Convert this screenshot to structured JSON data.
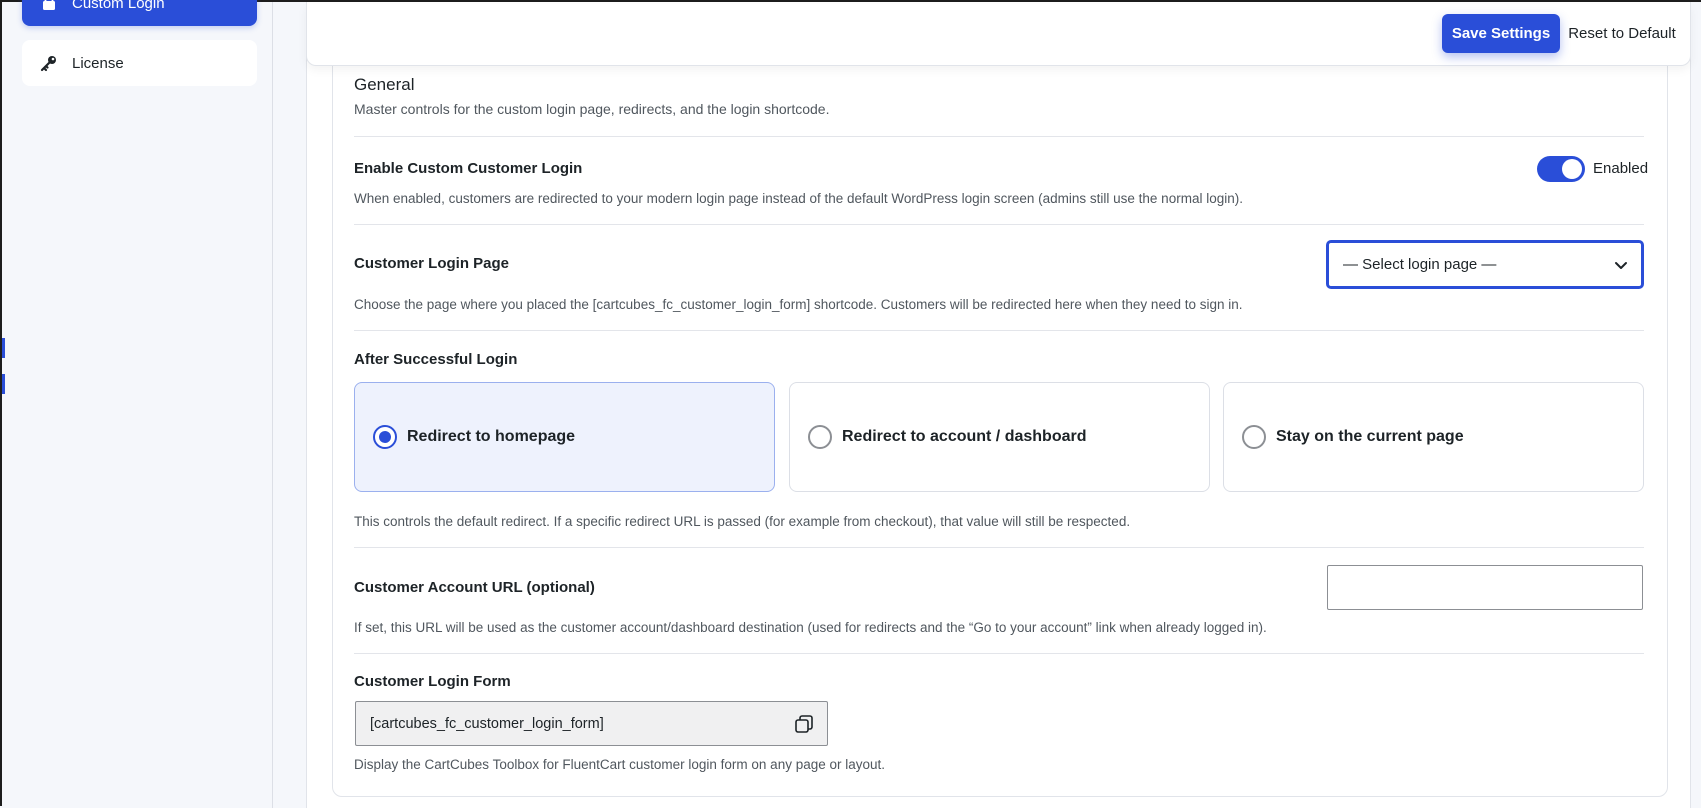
{
  "sidebar": {
    "active_item": {
      "label": "Custom Login",
      "icon": "lock-icon"
    },
    "items": [
      {
        "label": "License",
        "icon": "key-icon"
      }
    ]
  },
  "toolbar": {
    "save_label": "Save Settings",
    "reset_label": "Reset to Default"
  },
  "section": {
    "title": "General",
    "description": "Master controls for the custom login page, redirects, and the login shortcode."
  },
  "settings": {
    "enable_custom_login": {
      "label": "Enable Custom Customer Login",
      "state_label": "Enabled",
      "enabled": true,
      "help": "When enabled, customers are redirected to your modern login page instead of the default WordPress login screen (admins still use the normal login)."
    },
    "login_page": {
      "label": "Customer Login Page",
      "selected": "— Select login page —",
      "help": "Choose the page where you placed the [cartcubes_fc_customer_login_form] shortcode. Customers will be redirected here when they need to sign in."
    },
    "after_login": {
      "label": "After Successful Login",
      "options": [
        {
          "label": "Redirect to homepage",
          "selected": true
        },
        {
          "label": "Redirect to account / dashboard",
          "selected": false
        },
        {
          "label": "Stay on the current page",
          "selected": false
        }
      ],
      "help": "This controls the default redirect. If a specific redirect URL is passed (for example from checkout), that value will still be respected."
    },
    "account_url": {
      "label": "Customer Account URL (optional)",
      "value": "",
      "help": "If set, this URL will be used as the customer account/dashboard destination (used for redirects and the “Go to your account” link when already logged in)."
    },
    "login_form": {
      "label": "Customer Login Form",
      "shortcode": "[cartcubes_fc_customer_login_form]",
      "help": "Display the CartCubes Toolbox for FluentCart customer login form on any page or layout."
    }
  },
  "colors": {
    "accent": "#2a4ed8",
    "selected_bg": "#eef2fd"
  }
}
